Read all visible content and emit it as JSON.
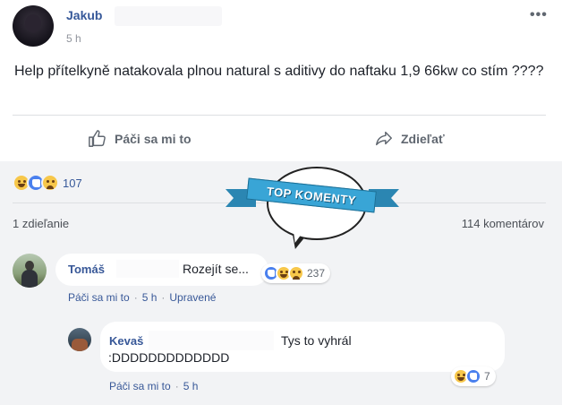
{
  "post": {
    "author": "Jakub",
    "time": "5 h",
    "menu": "•••",
    "text": "Help přítelkyně natakovala plnou natural s aditivy do naftaku 1,9 66kw co stím ????"
  },
  "actions": {
    "like": "Páči sa mi to",
    "share": "Zdieľať"
  },
  "stats": {
    "reactions_count": "107",
    "shares": "1 zdieľanie",
    "comments": "114 komentárov",
    "reaction_icons": [
      "haha-icon",
      "like-icon",
      "sad-icon"
    ]
  },
  "banner": {
    "label": "TOP KOMENTY"
  },
  "comments": [
    {
      "author": "Tomáš",
      "text": "Rozejít se...",
      "reactions_count": "237",
      "like": "Páči sa mi to",
      "time": "5 h",
      "edited": "Upravené"
    },
    {
      "author": "Kevaš",
      "text_line1": "Tys to vyhrál",
      "text_line2": ":DDDDDDDDDDDDD",
      "reactions_count": "7",
      "like": "Páči sa mi to",
      "time": "5 h"
    }
  ],
  "colors": {
    "link": "#365899",
    "muted": "#90949c",
    "section_bg": "#f2f3f5",
    "banner": "#39a5d6"
  }
}
